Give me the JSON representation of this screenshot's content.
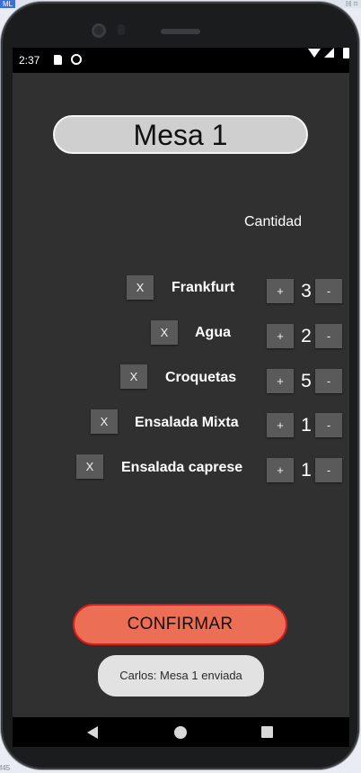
{
  "ide": {
    "tag": "ML",
    "marks": "ℍ ⌑",
    "footer": "f45"
  },
  "status_bar": {
    "time": "2:37",
    "icons": [
      "sd-card-icon",
      "cast-icon",
      "wifi-icon",
      "signal-icon",
      "battery-icon"
    ]
  },
  "table_title": "Mesa 1",
  "quantity_header": "Cantidad",
  "items": [
    {
      "remove_label": "X",
      "name": "Frankfurt",
      "plus_label": "+",
      "quantity": "3",
      "minus_label": "-"
    },
    {
      "remove_label": "X",
      "name": "Agua",
      "plus_label": "+",
      "quantity": "2",
      "minus_label": "-"
    },
    {
      "remove_label": "X",
      "name": "Croquetas",
      "plus_label": "+",
      "quantity": "5",
      "minus_label": "-"
    },
    {
      "remove_label": "X",
      "name": "Ensalada Mixta",
      "plus_label": "+",
      "quantity": "1",
      "minus_label": "-"
    },
    {
      "remove_label": "X",
      "name": "Ensalada caprese",
      "plus_label": "+",
      "quantity": "1",
      "minus_label": "-"
    }
  ],
  "confirm_label": "CONFIRMAR",
  "toast_text": "Carlos: Mesa 1 enviada",
  "colors": {
    "background": "#303030",
    "confirm_fill": "#ec6f55",
    "confirm_border": "#d81d1d",
    "title_pill": "#cfcfcf",
    "button": "#5a5a5a"
  }
}
